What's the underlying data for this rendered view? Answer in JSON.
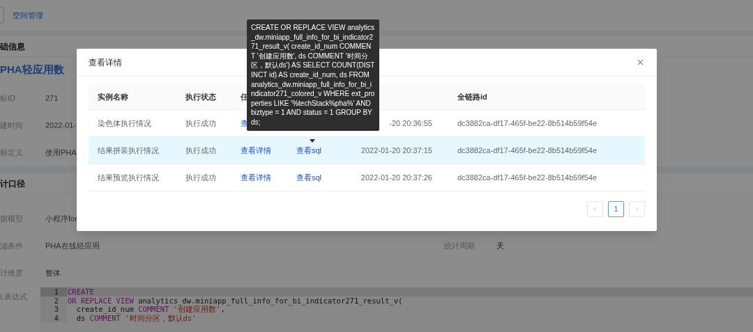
{
  "top_nav": {
    "link": "空间管理"
  },
  "sections": [
    {
      "title": "础信息",
      "headline": "PHA轻应用数",
      "fields": [
        {
          "label": "标ID",
          "value": "271"
        },
        {
          "label": "建时间",
          "value": "2022-01-"
        },
        {
          "label": "标定义",
          "value": "使用PHA"
        }
      ]
    },
    {
      "title": "计口径",
      "fields": [
        {
          "label": "据模型",
          "value": "小程序for"
        },
        {
          "label": "滤条件",
          "value": "PHA在线轻应用",
          "extra_label": "统计周期",
          "extra_value": "天"
        },
        {
          "label": "计维度",
          "value": "整体"
        }
      ]
    }
  ],
  "code": {
    "label": "L表达式",
    "lines": [
      {
        "number": "1",
        "active": true,
        "tokens": [
          {
            "kind": "keyword",
            "text": "CREATE"
          }
        ]
      },
      {
        "number": "2",
        "active": false,
        "tokens": [
          {
            "kind": "keyword",
            "text": "OR REPLACE VIEW"
          },
          {
            "kind": "plain",
            "text": " analytics_dw.miniapp_full_info_for_bi_indicator271_result_v("
          }
        ]
      },
      {
        "number": "3",
        "active": false,
        "tokens": [
          {
            "kind": "plain",
            "text": "  create_id_num "
          },
          {
            "kind": "keyword",
            "text": "COMMENT"
          },
          {
            "kind": "string",
            "text": " '创建应用数'"
          },
          {
            "kind": "plain",
            "text": ","
          }
        ]
      },
      {
        "number": "4",
        "active": false,
        "tokens": [
          {
            "kind": "plain",
            "text": "  ds "
          },
          {
            "kind": "keyword",
            "text": "COMMENT"
          },
          {
            "kind": "string",
            "text": " '时间分区，默认ds'"
          }
        ]
      }
    ]
  },
  "modal": {
    "title": "查看详情",
    "columns": [
      {
        "label": "实例名称"
      },
      {
        "label": "执行状态"
      },
      {
        "label": "任"
      },
      {},
      {},
      {
        "label": "全链路id"
      }
    ],
    "rows": [
      {
        "highlighted": false,
        "name": "染色体执行情况",
        "status": "执行成功",
        "detail_link": "查",
        "time": "-20 20:36:55",
        "trace_id": "dc3882ca-df17-465f-be22-8b514b59f54e"
      },
      {
        "highlighted": true,
        "name": "结果拼装执行情况",
        "status": "执行成功",
        "detail_link": "查看详情",
        "sql_link": "查看sql",
        "time": "2022-01-20 20:37:15",
        "trace_id": "dc3882ca-df17-465f-be22-8b514b59f54e"
      },
      {
        "highlighted": false,
        "name": "结果预览执行情况",
        "status": "执行成功",
        "detail_link": "查看详情",
        "sql_link": "查看sql",
        "time": "2022-01-20 20:37:26",
        "trace_id": "dc3882ca-df17-465f-be22-8b514b59f54e"
      }
    ],
    "pagination": {
      "prev_disabled": true,
      "pages": [
        {
          "label": "1",
          "selected": true
        }
      ],
      "next_disabled": true
    }
  },
  "tooltip": {
    "text": "CREATE OR REPLACE VIEW analytics_dw.miniapp_full_info_for_bi_indicator271_result_v( create_id_num COMMENT '创建应用数', ds COMMENT '时间分区，默认ds') AS SELECT COUNT(DISTINCT id) AS create_id_num, ds FROM analytics_dw.miniapp_full_info_for_bi_indicator271_colored_v WHERE ext_properties LIKE '%techStack%pha%' AND biztype = 1 AND status = 1 GROUP BY ds;"
  }
}
